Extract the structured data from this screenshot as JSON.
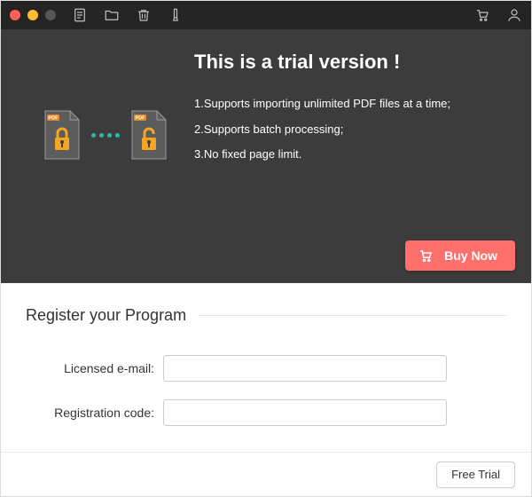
{
  "colors": {
    "accent": "#ff6f6b",
    "teal": "#2bb8a6",
    "dark": "#3c3c3c"
  },
  "hero": {
    "title": "This is a trial version !",
    "features": [
      "1.Supports importing unlimited PDF files at a time;",
      "2.Supports batch processing;",
      "3.No fixed page limit."
    ],
    "pdf_tag": "PDF",
    "buy_label": "Buy Now"
  },
  "register": {
    "title": "Register your Program",
    "email_label": "Licensed e-mail:",
    "code_label": "Registration code:",
    "email_value": "",
    "code_value": ""
  },
  "footer": {
    "free_trial_label": "Free Trial"
  },
  "icons": {
    "document": "document-icon",
    "folder": "folder-icon",
    "trash": "trash-icon",
    "marker": "marker-icon",
    "cart": "cart-icon",
    "user": "user-icon",
    "lock_closed": "lock-closed-icon",
    "lock_open": "lock-open-icon"
  }
}
